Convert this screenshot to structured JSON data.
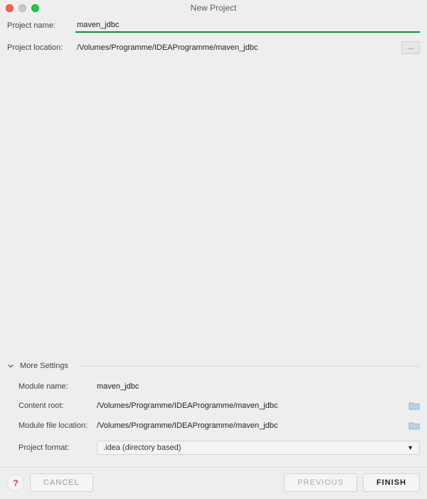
{
  "window": {
    "title": "New Project"
  },
  "fields": {
    "project_name": {
      "label": "Project name:",
      "value": "maven_jdbc"
    },
    "project_location": {
      "label": "Project location:",
      "value": "/Volumes/Programme/IDEAProgramme/maven_jdbc",
      "browse_label": "..."
    }
  },
  "more_settings": {
    "title": "More Settings",
    "module_name": {
      "label": "Module name:",
      "value": "maven_jdbc"
    },
    "content_root": {
      "label": "Content root:",
      "value": "/Volumes/Programme/IDEAProgramme/maven_jdbc"
    },
    "module_file_location": {
      "label": "Module file location:",
      "value": "/Volumes/Programme/IDEAProgramme/maven_jdbc"
    },
    "project_format": {
      "label": "Project format:",
      "value": ".idea (directory based)"
    }
  },
  "footer": {
    "cancel": "CANCEL",
    "previous": "PREVIOUS",
    "finish": "FINISH"
  }
}
